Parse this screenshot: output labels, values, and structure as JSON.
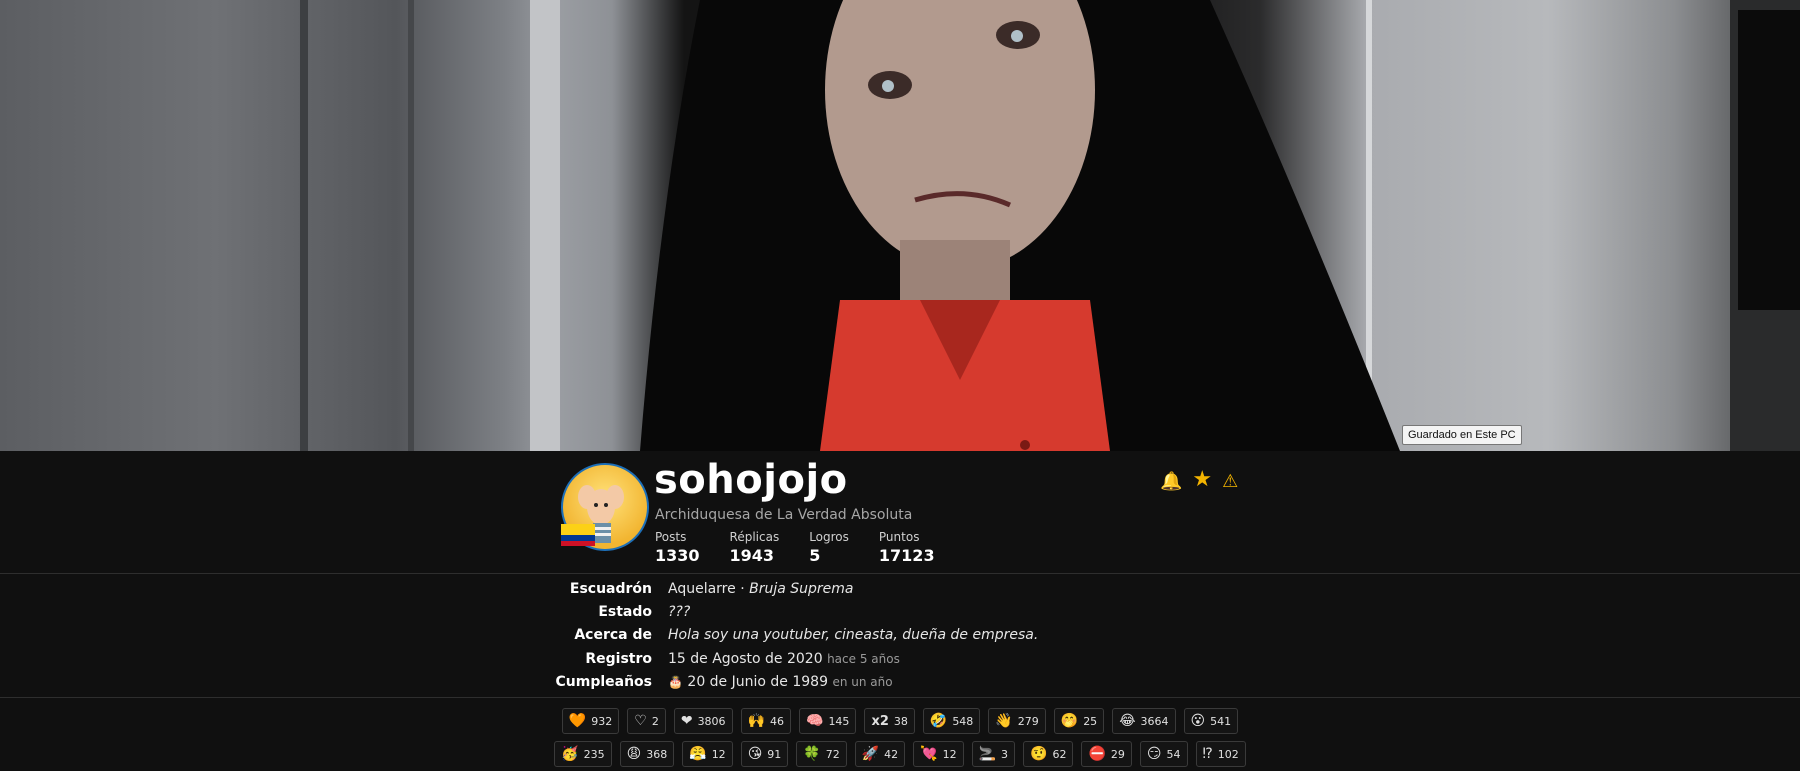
{
  "banner": {
    "tooltip": "Guardado en Este PC"
  },
  "profile": {
    "username": "sohojojo",
    "subtitle": "Archiduquesa de La Verdad Absoluta",
    "flag_colors": [
      "#fcd116",
      "#003893",
      "#ce1126"
    ],
    "stats": [
      {
        "label": "Posts",
        "value": "1330"
      },
      {
        "label": "Réplicas",
        "value": "1943"
      },
      {
        "label": "Logros",
        "value": "5"
      },
      {
        "label": "Puntos",
        "value": "17123"
      }
    ],
    "actions": [
      {
        "name": "bell-icon",
        "glyph": "🔔"
      },
      {
        "name": "star-icon",
        "glyph": "★"
      },
      {
        "name": "warning-icon",
        "glyph": "⚠"
      }
    ]
  },
  "info": {
    "escuadron_label": "Escuadrón",
    "escuadron_value": "Aquelarre ·",
    "escuadron_rank": "Bruja Suprema",
    "estado_label": "Estado",
    "estado_value": "???",
    "acerca_label": "Acerca de",
    "acerca_value": "Hola soy una youtuber, cineasta, dueña de empresa.",
    "registro_label": "Registro",
    "registro_value": "15 de Agosto de 2020",
    "registro_ago": "hace 5 años",
    "cumple_label": "Cumpleaños",
    "cumple_icon": "🎂",
    "cumple_value": "20 de Junio de 1989",
    "cumple_rel": "en un año"
  },
  "reactions_row1": [
    {
      "icon": "🧡",
      "name": "orange-heart-icon",
      "count": "932"
    },
    {
      "icon": "♡",
      "name": "heart-outline-icon",
      "count": "2"
    },
    {
      "icon": "❤",
      "name": "red-heart-icon",
      "count": "3806"
    },
    {
      "icon": "🙌",
      "name": "raised-hands-icon",
      "count": "46"
    },
    {
      "icon": "🧠",
      "name": "brain-icon",
      "count": "145"
    },
    {
      "icon": "x2",
      "name": "x2-icon",
      "count": "38"
    },
    {
      "icon": "🤣",
      "name": "rofl-icon",
      "count": "548"
    },
    {
      "icon": "👋",
      "name": "waving-hand-icon",
      "count": "279"
    },
    {
      "icon": "🤭",
      "name": "hand-over-mouth-icon",
      "count": "25"
    },
    {
      "icon": "😂",
      "name": "tears-of-joy-icon",
      "count": "3664"
    },
    {
      "icon": "😮",
      "name": "astonished-icon",
      "count": "541"
    }
  ],
  "reactions_row2": [
    {
      "icon": "🥳",
      "name": "party-face-icon",
      "count": "235"
    },
    {
      "icon": "😩",
      "name": "weary-face-icon",
      "count": "368"
    },
    {
      "icon": "😤",
      "name": "huffing-face-icon",
      "count": "12"
    },
    {
      "icon": "😘",
      "name": "kiss-face-icon",
      "count": "91"
    },
    {
      "icon": "🍀",
      "name": "clover-icon",
      "count": "72"
    },
    {
      "icon": "🚀",
      "name": "rocket-icon",
      "count": "42"
    },
    {
      "icon": "💘",
      "name": "heart-arrow-icon",
      "count": "12"
    },
    {
      "icon": "🚬",
      "name": "cigarette-icon",
      "count": "3"
    },
    {
      "icon": "🤨",
      "name": "raised-eyebrow-icon",
      "count": "62"
    },
    {
      "icon": "⛔",
      "name": "no-entry-icon",
      "count": "29"
    },
    {
      "icon": "😏",
      "name": "smirk-icon",
      "count": "54"
    },
    {
      "icon": "⁉",
      "name": "exclamation-question-icon",
      "count": "102"
    }
  ]
}
